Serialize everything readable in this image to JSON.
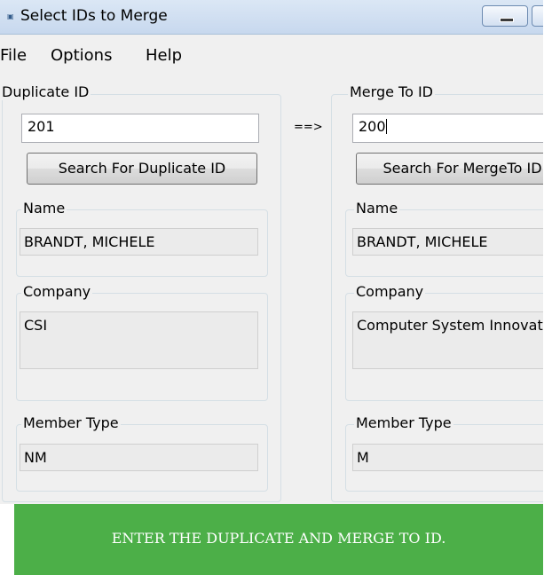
{
  "window": {
    "title": "Select IDs to Merge"
  },
  "menu": {
    "items": [
      "File",
      "Options",
      "Help"
    ]
  },
  "left": {
    "group_label": "Duplicate ID",
    "id_value": "201",
    "search_button": "Search For Duplicate ID",
    "name_label": "Name",
    "name_value": "BRANDT, MICHELE",
    "company_label": "Company",
    "company_value": "CSI",
    "member_type_label": "Member Type",
    "member_type_value": "NM"
  },
  "arrow": "==>",
  "right": {
    "group_label": "Merge To ID",
    "id_value": "200",
    "search_button": "Search For MergeTo ID",
    "name_label": "Name",
    "name_value": "BRANDT, MICHELE",
    "company_label": "Company",
    "company_value": "Computer System Innovations",
    "member_type_label": "Member Type",
    "member_type_value": "M"
  },
  "banner": {
    "text": "ENTER THE DUPLICATE AND MERGE TO ID."
  }
}
